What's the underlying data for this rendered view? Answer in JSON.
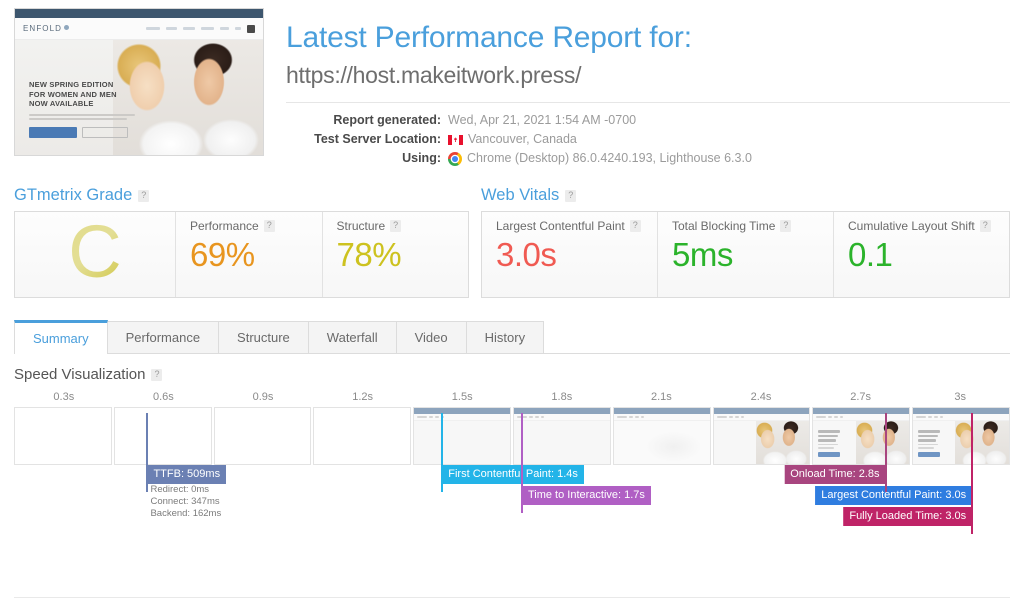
{
  "report": {
    "title": "Latest Performance Report for:",
    "url": "https://host.makeitwork.press/",
    "meta": [
      {
        "label": "Report generated:",
        "value": "Wed, Apr 21, 2021 1:54 AM -0700",
        "icon": ""
      },
      {
        "label": "Test Server Location:",
        "value": "Vancouver, Canada",
        "icon": "canada-flag-icon"
      },
      {
        "label": "Using:",
        "value": "Chrome (Desktop) 86.0.4240.193, Lighthouse 6.3.0",
        "icon": "chrome-icon"
      }
    ]
  },
  "thumbnail": {
    "site_logo": "ENFOLD",
    "hero_line1": "NEW SPRING EDITION",
    "hero_line2": "FOR WOMEN AND MEN",
    "hero_line3": "NOW AVAILABLE"
  },
  "grade_panel": {
    "heading": "GTmetrix Grade",
    "help": "?",
    "grade": "C",
    "grade_color": "#ccc23c",
    "metrics": [
      {
        "label": "Performance",
        "help": "?",
        "value": "69%",
        "color": "#e8951f"
      },
      {
        "label": "Structure",
        "help": "?",
        "value": "78%",
        "color": "#cdc21f"
      }
    ]
  },
  "vitals_panel": {
    "heading": "Web Vitals",
    "help": "?",
    "metrics": [
      {
        "label": "Largest Contentful Paint",
        "help": "?",
        "value": "3.0s",
        "color": "#f05a52"
      },
      {
        "label": "Total Blocking Time",
        "help": "?",
        "value": "5ms",
        "color": "#2bb32b"
      },
      {
        "label": "Cumulative Layout Shift",
        "help": "?",
        "value": "0.1",
        "color": "#2bb32b"
      }
    ]
  },
  "tabs": [
    {
      "label": "Summary",
      "active": true
    },
    {
      "label": "Performance",
      "active": false
    },
    {
      "label": "Structure",
      "active": false
    },
    {
      "label": "Waterfall",
      "active": false
    },
    {
      "label": "Video",
      "active": false
    },
    {
      "label": "History",
      "active": false
    }
  ],
  "speed_visualization": {
    "heading": "Speed Visualization",
    "help": "?",
    "ticks": [
      "0.3s",
      "0.6s",
      "0.9s",
      "1.2s",
      "1.5s",
      "1.8s",
      "2.1s",
      "2.4s",
      "2.7s",
      "3s"
    ],
    "frames": [
      {
        "state": "blank"
      },
      {
        "state": "blank"
      },
      {
        "state": "blank"
      },
      {
        "state": "blank"
      },
      {
        "state": "chrome-empty"
      },
      {
        "state": "chrome-empty"
      },
      {
        "state": "faint"
      },
      {
        "state": "photo"
      },
      {
        "state": "photo-text"
      },
      {
        "state": "photo-text"
      }
    ],
    "markers": [
      {
        "name": "ttfb",
        "label": "TTFB: 509ms",
        "color": "#6b80b3",
        "x_pct": 13.4,
        "badge_align": "left",
        "badge_row": 0,
        "details": [
          "Redirect: 0ms",
          "Connect: 347ms",
          "Backend: 162ms"
        ]
      },
      {
        "name": "first-contentful-paint",
        "label": "First Contentful Paint: 1.4s",
        "color": "#23b4e8",
        "x_pct": 43.0,
        "badge_align": "left",
        "badge_row": 0
      },
      {
        "name": "time-to-interactive",
        "label": "Time to Interactive: 1.7s",
        "color": "#b05fc4",
        "x_pct": 51.0,
        "badge_align": "left",
        "badge_row": 1
      },
      {
        "name": "onload-time",
        "label": "Onload Time: 2.8s",
        "color": "#a8457f",
        "x_pct": 87.5,
        "badge_align": "right",
        "badge_row": 0
      },
      {
        "name": "largest-contentful-paint",
        "label": "Largest Contentful Paint: 3.0s",
        "color": "#2f7de0",
        "x_pct": 96.2,
        "badge_align": "right",
        "badge_row": 1
      },
      {
        "name": "fully-loaded-time",
        "label": "Fully Loaded Time: 3.0s",
        "color": "#bf2367",
        "x_pct": 96.2,
        "badge_align": "right",
        "badge_row": 2
      }
    ]
  }
}
